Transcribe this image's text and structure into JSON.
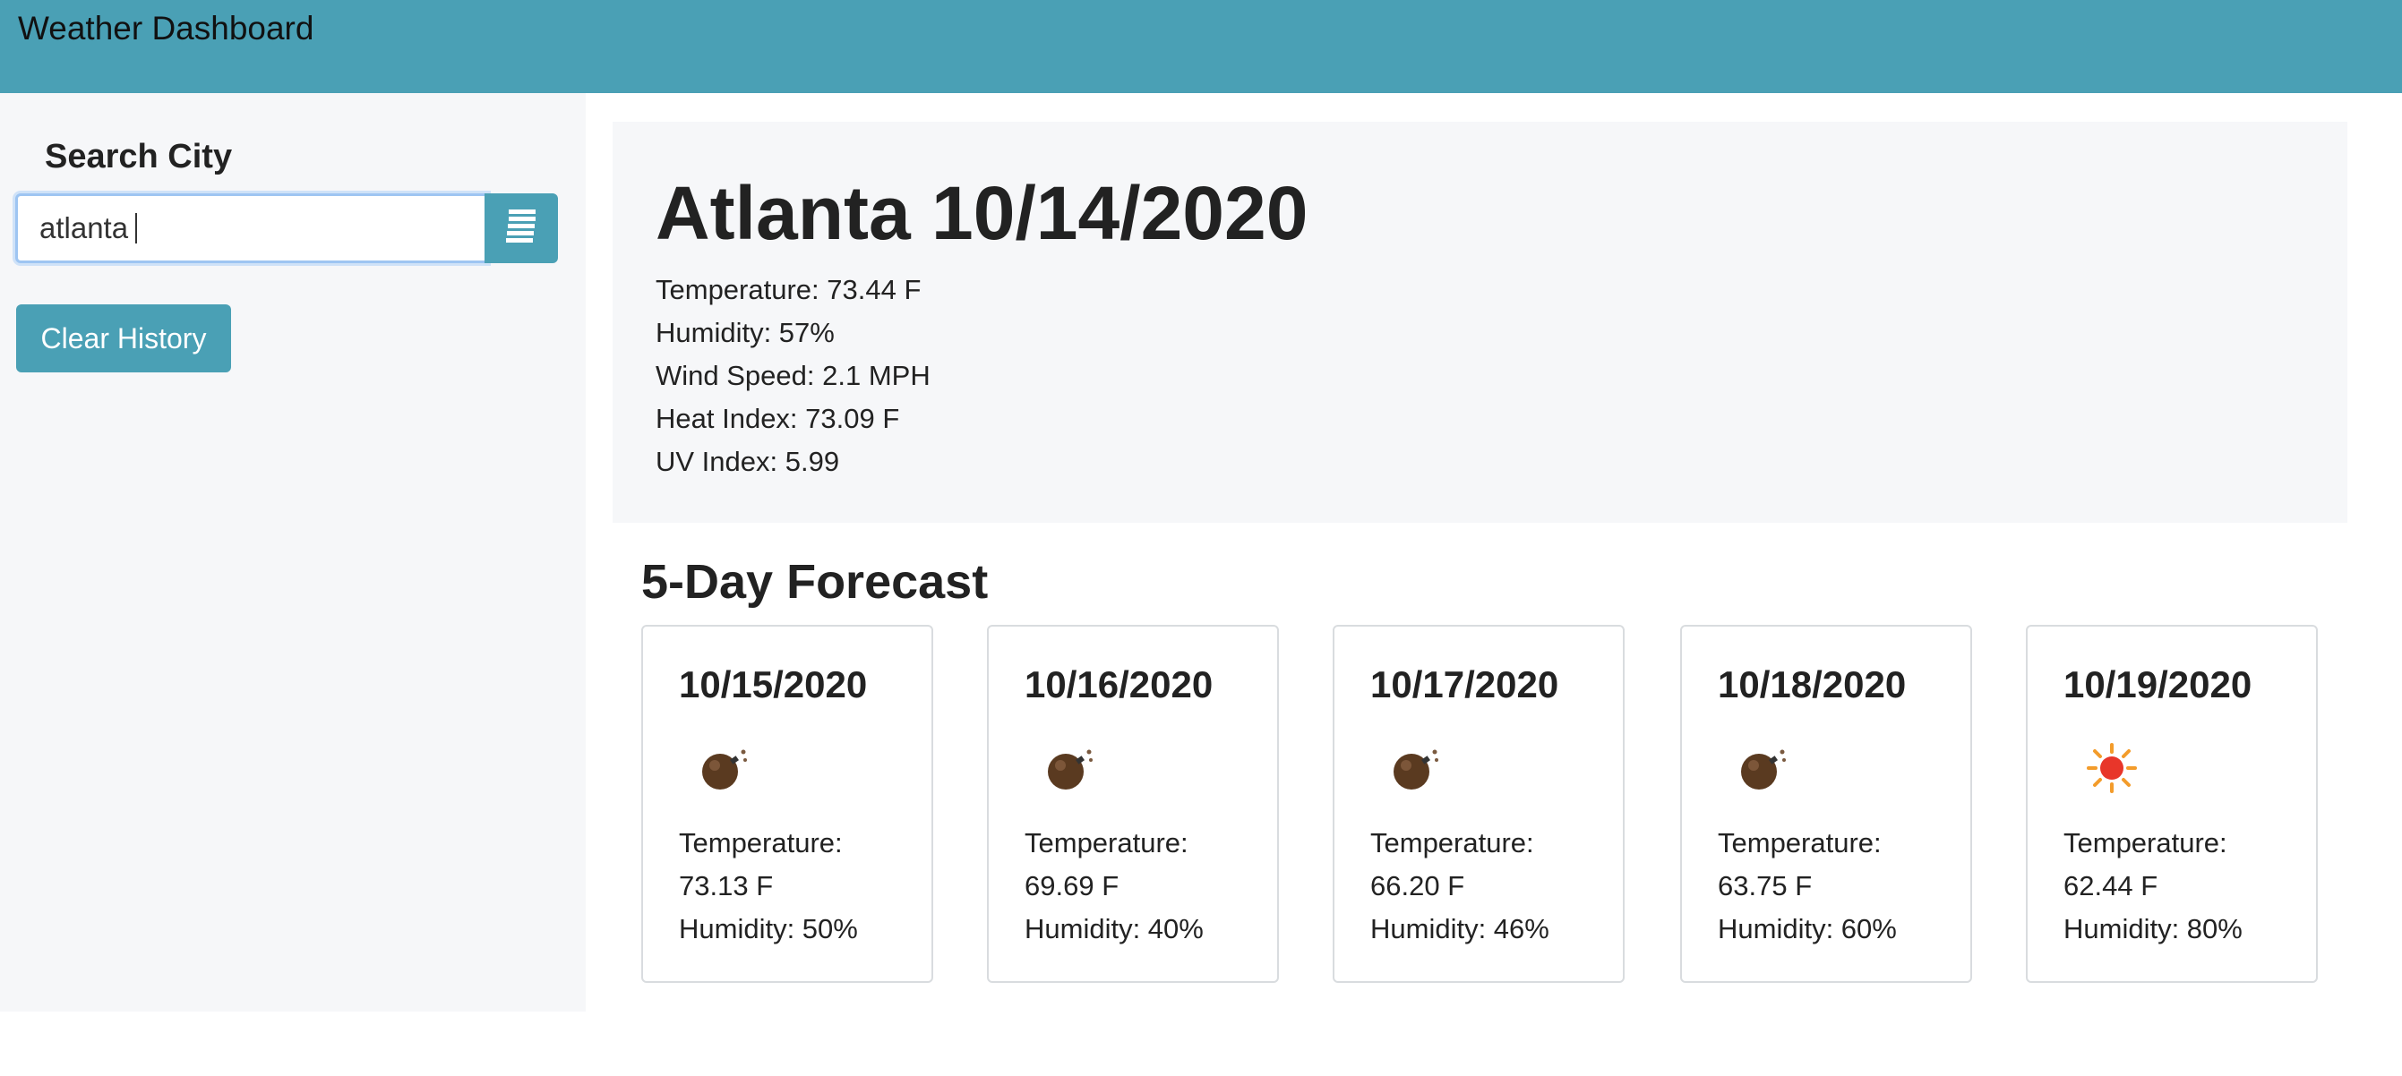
{
  "header": {
    "title": "Weather Dashboard"
  },
  "sidebar": {
    "search_label": "Search City",
    "search_value": "atlanta",
    "search_button_icon": "list-icon",
    "clear_label": "Clear History"
  },
  "current": {
    "heading": "Atlanta 10/14/2020",
    "temperature": "Temperature: 73.44 F",
    "humidity": "Humidity: 57%",
    "wind": "Wind Speed: 2.1 MPH",
    "heat_index": "Heat Index: 73.09 F",
    "uv_index": "UV Index: 5.99"
  },
  "forecast": {
    "title": "5-Day Forecast",
    "days": [
      {
        "date": "10/15/2020",
        "icon": "bomb-icon",
        "temp_label": "Temperature:",
        "temp": "73.13 F",
        "humidity": "Humidity: 50%"
      },
      {
        "date": "10/16/2020",
        "icon": "bomb-icon",
        "temp_label": "Temperature:",
        "temp": "69.69 F",
        "humidity": "Humidity: 40%"
      },
      {
        "date": "10/17/2020",
        "icon": "bomb-icon",
        "temp_label": "Temperature:",
        "temp": "66.20 F",
        "humidity": "Humidity: 46%"
      },
      {
        "date": "10/18/2020",
        "icon": "bomb-icon",
        "temp_label": "Temperature:",
        "temp": "63.75 F",
        "humidity": "Humidity: 60%"
      },
      {
        "date": "10/19/2020",
        "icon": "sun-icon",
        "temp_label": "Temperature:",
        "temp": "62.44 F",
        "humidity": "Humidity: 80%"
      }
    ]
  },
  "colors": {
    "accent": "#4aa0b5",
    "panel": "#f6f7f9"
  }
}
